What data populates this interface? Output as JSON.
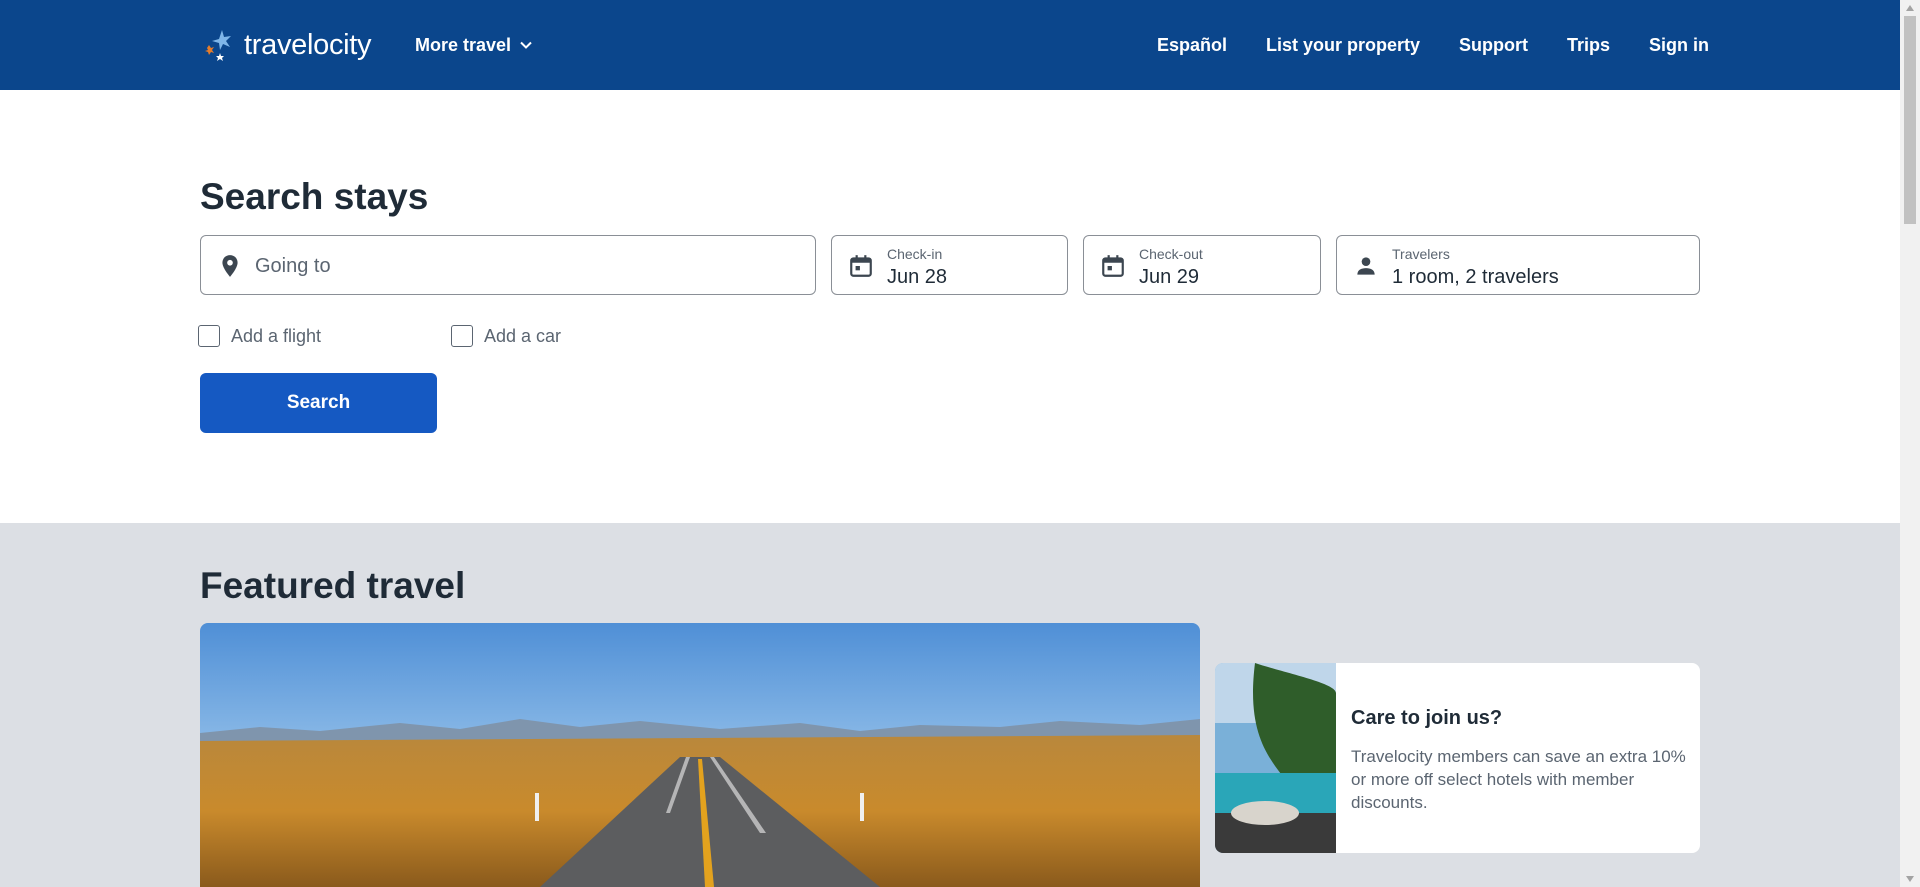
{
  "header": {
    "logo_text": "travelocity",
    "more_travel_label": "More travel",
    "nav": [
      "Español",
      "List your property",
      "Support",
      "Trips",
      "Sign in"
    ]
  },
  "search": {
    "title": "Search stays",
    "destination_placeholder": "Going to",
    "checkin_label": "Check-in",
    "checkin_value": "Jun 28",
    "checkout_label": "Check-out",
    "checkout_value": "Jun 29",
    "travelers_label": "Travelers",
    "travelers_value": "1 room, 2 travelers",
    "add_flight_label": "Add a flight",
    "add_car_label": "Add a car",
    "search_button_label": "Search"
  },
  "featured": {
    "title": "Featured travel",
    "promo_title": "Care to join us?",
    "promo_body": "Travelocity members can save an extra 10% or more off select hotels with member discounts."
  },
  "colors": {
    "header_bg": "#0b468c",
    "search_button": "#1559c2",
    "featured_bg": "#dcdfe4"
  },
  "icons": [
    "location-pin-icon",
    "calendar-icon",
    "person-icon",
    "chevron-down-icon"
  ]
}
